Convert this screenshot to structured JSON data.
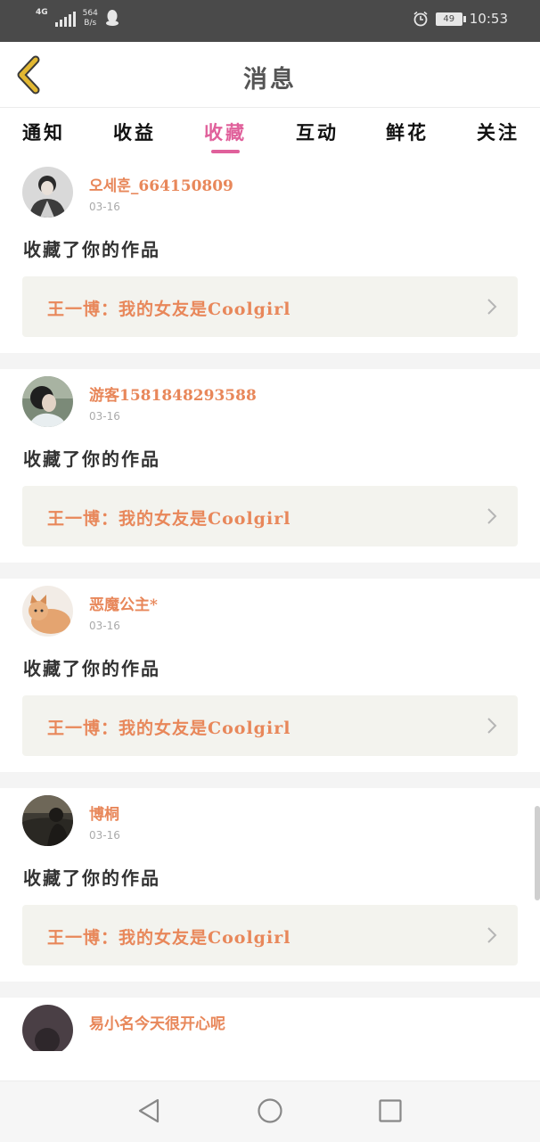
{
  "status_bar": {
    "network": "4G",
    "speed_value": "564",
    "speed_unit": "B/s",
    "battery": "49",
    "time": "10:53"
  },
  "header": {
    "title": "消息"
  },
  "tabs": [
    {
      "label": "通知",
      "active": false
    },
    {
      "label": "收益",
      "active": false
    },
    {
      "label": "收藏",
      "active": true
    },
    {
      "label": "互动",
      "active": false
    },
    {
      "label": "鲜花",
      "active": false
    },
    {
      "label": "关注",
      "active": false
    }
  ],
  "items": [
    {
      "username": "오세훈_664150809",
      "date": "03-16",
      "action": "收藏了你的作品",
      "work_title": "王一博：我的女友是Coolgirl"
    },
    {
      "username": "游客1581848293588",
      "date": "03-16",
      "action": "收藏了你的作品",
      "work_title": "王一博：我的女友是Coolgirl"
    },
    {
      "username": "恶魔公主*",
      "date": "03-16",
      "action": "收藏了你的作品",
      "work_title": "王一博：我的女友是Coolgirl"
    },
    {
      "username": "博桐",
      "date": "03-16",
      "action": "收藏了你的作品",
      "work_title": "王一博：我的女友是Coolgirl"
    },
    {
      "username": "易小名今天很开心呢"
    }
  ],
  "colors": {
    "accent": "#e0609b",
    "username": "#e8875a",
    "back_arrow": "#e2b832"
  }
}
